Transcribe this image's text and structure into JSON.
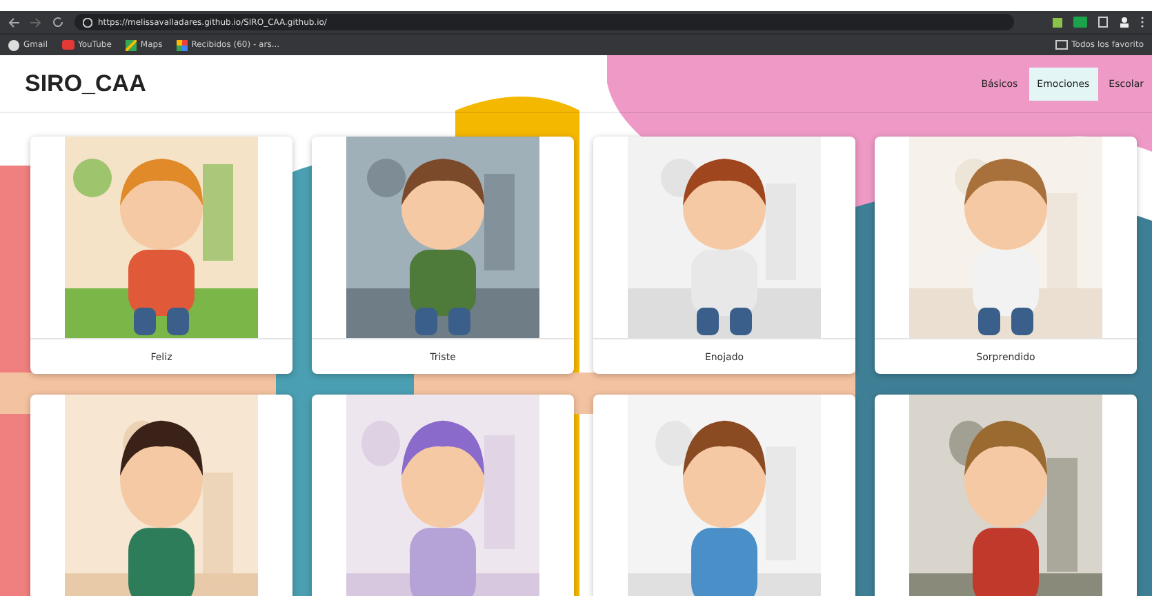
{
  "browser": {
    "url": "https://melissavalladares.github.io/SIRO_CAA.github.io/",
    "bookmarks": [
      {
        "label": "Gmail",
        "kind": "gmail"
      },
      {
        "label": "YouTube",
        "kind": "youtube"
      },
      {
        "label": "Maps",
        "kind": "maps"
      },
      {
        "label": "Recibidos (60) - ars...",
        "kind": "photos"
      }
    ],
    "other_bookmarks": "Todos los favorito"
  },
  "app": {
    "title": "SIRO_CAA",
    "nav": [
      {
        "label": "Básicos",
        "selected": false
      },
      {
        "label": "Emociones",
        "selected": true
      },
      {
        "label": "Escolar",
        "selected": false
      }
    ],
    "cards": [
      {
        "kind": "labeled",
        "label": "Feliz"
      },
      {
        "kind": "labeled",
        "label": "Triste"
      },
      {
        "kind": "labeled",
        "label": "Enojado"
      },
      {
        "kind": "labeled",
        "label": "Sorprendido"
      },
      {
        "kind": "picture"
      },
      {
        "kind": "picture"
      },
      {
        "kind": "picture"
      },
      {
        "kind": "picture"
      }
    ]
  }
}
